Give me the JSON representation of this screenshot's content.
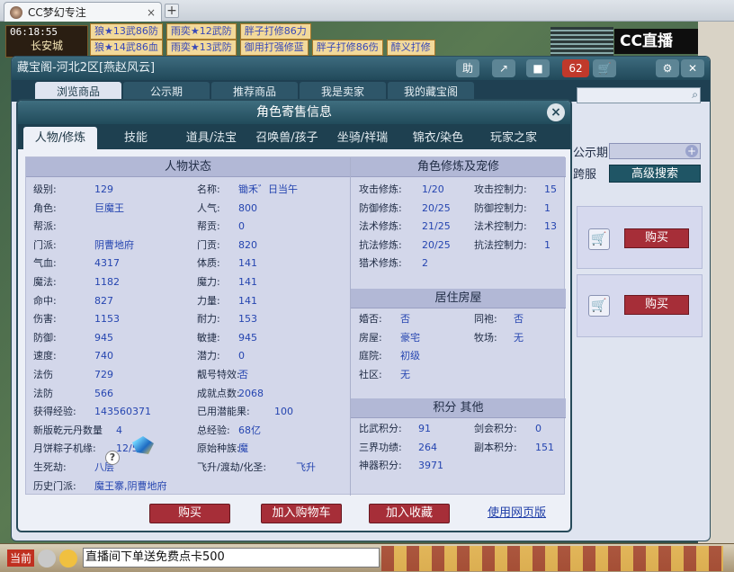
{
  "browser": {
    "tab_title": "CC梦幻专注",
    "tab_close": "×",
    "new_tab": "+"
  },
  "game_hud": {
    "time": "06:18:55",
    "city": "长安城",
    "messages_row1": [
      "狼★13武86防",
      "雨奕★12武防",
      "胖子打修86力"
    ],
    "messages_row2": [
      "狼★14武86血",
      "雨奕★13武防",
      "御用打强修蓝",
      "胖子打修86伤",
      "醉义打修"
    ],
    "brand": "CC直播"
  },
  "treasure_window": {
    "title": "藏宝阁-河北2区[燕赵风云]",
    "title_buttons": [
      "助",
      "↗",
      "■",
      "62",
      "🛒"
    ],
    "nav_tabs": [
      "浏览商品",
      "公示期",
      "推荐商品",
      "我是卖家",
      "我的藏宝阁"
    ],
    "label_notice": "公示期",
    "label_cross": "跨服",
    "advanced_search": "高级搜索",
    "buy_label": "购买"
  },
  "dialog": {
    "title": "角色寄售信息",
    "close": "×",
    "tabs": [
      "人物/修炼",
      "技能",
      "道具/法宝",
      "召唤兽/孩子",
      "坐骑/祥瑞",
      "锦衣/染色",
      "玩家之家"
    ],
    "active_tab": 0,
    "status_header": "人物状态",
    "status_left": [
      {
        "k": "级别:",
        "v": "129"
      },
      {
        "k": "角色:",
        "v": "巨魔王"
      },
      {
        "k": "帮派:",
        "v": ""
      },
      {
        "k": "门派:",
        "v": "阴曹地府"
      },
      {
        "k": "气血:",
        "v": "4317"
      },
      {
        "k": "魔法:",
        "v": "1182"
      },
      {
        "k": "命中:",
        "v": "827"
      },
      {
        "k": "伤害:",
        "v": "1153"
      },
      {
        "k": "防御:",
        "v": "945"
      },
      {
        "k": "速度:",
        "v": "740"
      },
      {
        "k": "法伤",
        "v": "729"
      },
      {
        "k": "法防",
        "v": "566"
      },
      {
        "k": "获得经验:",
        "v": "143560371"
      },
      {
        "k": "新版乾元丹数量",
        "v": "4"
      },
      {
        "k": "月饼粽子机缘:",
        "v": "12/51"
      },
      {
        "k": "生死劫:",
        "v": "八层"
      },
      {
        "k": "历史门派:",
        "v": "魔王寨,阴曹地府"
      }
    ],
    "status_right": [
      {
        "k": "名称:",
        "v": "锄禾゛日当午"
      },
      {
        "k": "人气:",
        "v": "800"
      },
      {
        "k": "帮贡:",
        "v": "0"
      },
      {
        "k": "门贡:",
        "v": "820"
      },
      {
        "k": "体质:",
        "v": "141"
      },
      {
        "k": "魔力:",
        "v": "141"
      },
      {
        "k": "力量:",
        "v": "141"
      },
      {
        "k": "耐力:",
        "v": "153"
      },
      {
        "k": "敏捷:",
        "v": "945"
      },
      {
        "k": "潜力:",
        "v": "0"
      },
      {
        "k": "靓号特效:",
        "v": "否"
      },
      {
        "k": "成就点数:",
        "v": "2068"
      },
      {
        "k": "已用潜能果:",
        "v": "100"
      },
      {
        "k": "总经验:",
        "v": "68亿"
      },
      {
        "k": "原始种族:",
        "v": "魔"
      },
      {
        "k": "飞升/渡劫/化圣:",
        "v": "飞升"
      }
    ],
    "cultivation_header": "角色修炼及宠修",
    "cultivation_left": [
      {
        "k": "攻击修炼:",
        "v": "1/20"
      },
      {
        "k": "防御修炼:",
        "v": "20/25"
      },
      {
        "k": "法术修炼:",
        "v": "21/25"
      },
      {
        "k": "抗法修炼:",
        "v": "20/25"
      },
      {
        "k": "猎术修炼:",
        "v": "2"
      }
    ],
    "cultivation_right": [
      {
        "k": "攻击控制力:",
        "v": "15"
      },
      {
        "k": "防御控制力:",
        "v": "1"
      },
      {
        "k": "法术控制力:",
        "v": "13"
      },
      {
        "k": "抗法控制力:",
        "v": "1"
      }
    ],
    "housing_header": "居住房屋",
    "housing_left": [
      {
        "k": "婚否:",
        "v": "否"
      },
      {
        "k": "房屋:",
        "v": "豪宅"
      },
      {
        "k": "庭院:",
        "v": "初级"
      },
      {
        "k": "社区:",
        "v": "无"
      }
    ],
    "housing_right": [
      {
        "k": "同袍:",
        "v": "否"
      },
      {
        "k": "牧场:",
        "v": "无"
      }
    ],
    "points_header": "积分 其他",
    "points_left": [
      {
        "k": "比武积分:",
        "v": "91"
      },
      {
        "k": "三界功绩:",
        "v": "264"
      },
      {
        "k": "神器积分:",
        "v": "3971"
      }
    ],
    "points_right": [
      {
        "k": "剑会积分:",
        "v": "0"
      },
      {
        "k": "副本积分:",
        "v": "151"
      }
    ],
    "btn_buy": "购买",
    "btn_cart": "加入购物车",
    "btn_fav": "加入收藏",
    "link_web": "使用网页版"
  },
  "bottom_bar": {
    "now_label": "当前",
    "chat_text": "直播间下单送免费点卡500"
  },
  "colors": {
    "title_bar": "#21495a",
    "buy_red": "#a62e38",
    "value_blue": "#2545b0"
  }
}
